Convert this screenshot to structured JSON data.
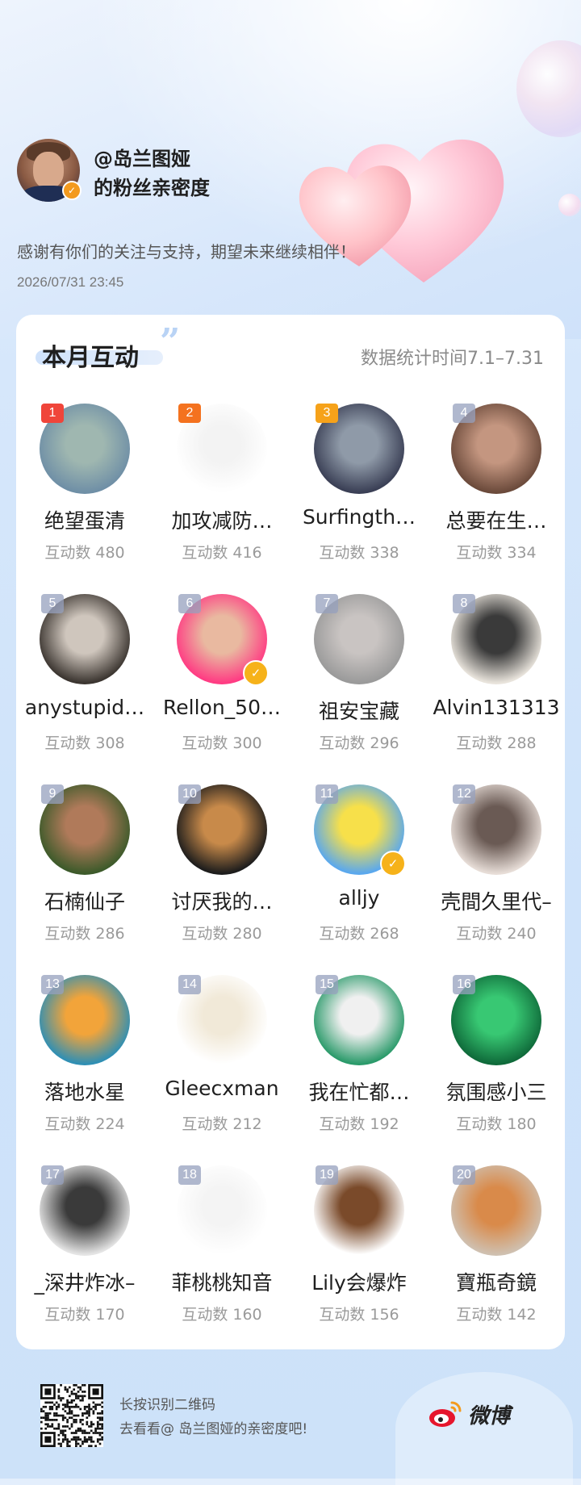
{
  "header": {
    "owner_handle": "@岛兰图娅",
    "owner_subtitle": "的粉丝亲密度",
    "thanks_message": "感谢有你们的关注与支持，期望未来继续相伴！",
    "timestamp": "2026/07/31 23:45"
  },
  "card": {
    "title": "本月互动",
    "stats_range": "数据统计时间7.1–7.31"
  },
  "fans": [
    {
      "rank": "1",
      "name": "绝望蛋清",
      "count": "互动数 480",
      "verified": false,
      "colors": [
        "#6f8fa6",
        "#9fb7b0"
      ]
    },
    {
      "rank": "2",
      "name": "加攻减防…",
      "count": "互动数 416",
      "verified": false,
      "colors": [
        "#ffffff",
        "#f3f3f3"
      ]
    },
    {
      "rank": "3",
      "name": "Surfingth…",
      "count": "互动数 338",
      "verified": false,
      "colors": [
        "#3a3f55",
        "#8f9aa8"
      ]
    },
    {
      "rank": "4",
      "name": "总要在生…",
      "count": "互动数 334",
      "verified": false,
      "colors": [
        "#6b4a3b",
        "#c49680"
      ]
    },
    {
      "rank": "5",
      "name": "anystupid…",
      "count": "互动数 308",
      "verified": false,
      "colors": [
        "#3b3530",
        "#cfc6bd"
      ]
    },
    {
      "rank": "6",
      "name": "Rellon_50…",
      "count": "互动数 300",
      "verified": true,
      "colors": [
        "#ff3b83",
        "#e9b9a0"
      ]
    },
    {
      "rank": "7",
      "name": "祖安宝藏",
      "count": "互动数 296",
      "verified": false,
      "colors": [
        "#9a9a9a",
        "#c9c4c2"
      ]
    },
    {
      "rank": "8",
      "name": "Alvin131313",
      "count": "互动数 288",
      "verified": false,
      "colors": [
        "#e9e4dc",
        "#3a3a3a"
      ]
    },
    {
      "rank": "9",
      "name": "石楠仙子",
      "count": "互动数 286",
      "verified": false,
      "colors": [
        "#3c5a2a",
        "#b07a5a"
      ]
    },
    {
      "rank": "10",
      "name": "讨厌我的…",
      "count": "互动数 280",
      "verified": false,
      "colors": [
        "#1c1c1c",
        "#c88a4a"
      ]
    },
    {
      "rank": "11",
      "name": "alljy",
      "count": "互动数 268",
      "verified": true,
      "colors": [
        "#5aa8ee",
        "#f7e04a"
      ]
    },
    {
      "rank": "12",
      "name": "壳間久里代–",
      "count": "互动数 240",
      "verified": false,
      "colors": [
        "#e7ddd7",
        "#6a5a54"
      ]
    },
    {
      "rank": "13",
      "name": "落地水星",
      "count": "互动数 224",
      "verified": false,
      "colors": [
        "#2f8fb4",
        "#f2a43a"
      ]
    },
    {
      "rank": "14",
      "name": "Gleecxman",
      "count": "互动数 212",
      "verified": false,
      "colors": [
        "#ffffff",
        "#f1e9d8"
      ]
    },
    {
      "rank": "15",
      "name": "我在忙都…",
      "count": "互动数 192",
      "verified": false,
      "colors": [
        "#2a9a6a",
        "#f0f0f0"
      ]
    },
    {
      "rank": "16",
      "name": "氛围感小三",
      "count": "互动数 180",
      "verified": false,
      "colors": [
        "#0f6a3a",
        "#38c873"
      ]
    },
    {
      "rank": "17",
      "name": "_深井炸冰–",
      "count": "互动数 170",
      "verified": false,
      "colors": [
        "#e4e4e4",
        "#3a3a3a"
      ]
    },
    {
      "rank": "18",
      "name": "菲桃桃知音",
      "count": "互动数 160",
      "verified": false,
      "colors": [
        "#ffffff",
        "#f4f4f4"
      ]
    },
    {
      "rank": "19",
      "name": "Lily会爆炸",
      "count": "互动数 156",
      "verified": false,
      "colors": [
        "#ffffff",
        "#7a4a2a"
      ]
    },
    {
      "rank": "20",
      "name": "寶瓶奇鏡",
      "count": "互动数 142",
      "verified": false,
      "colors": [
        "#cfc0b0",
        "#d98a4a"
      ]
    }
  ],
  "footer": {
    "qr_hint_line1": "长按识别二维码",
    "qr_hint_line2": "去看看@ 岛兰图娅的亲密度吧!",
    "brand": "微博"
  }
}
